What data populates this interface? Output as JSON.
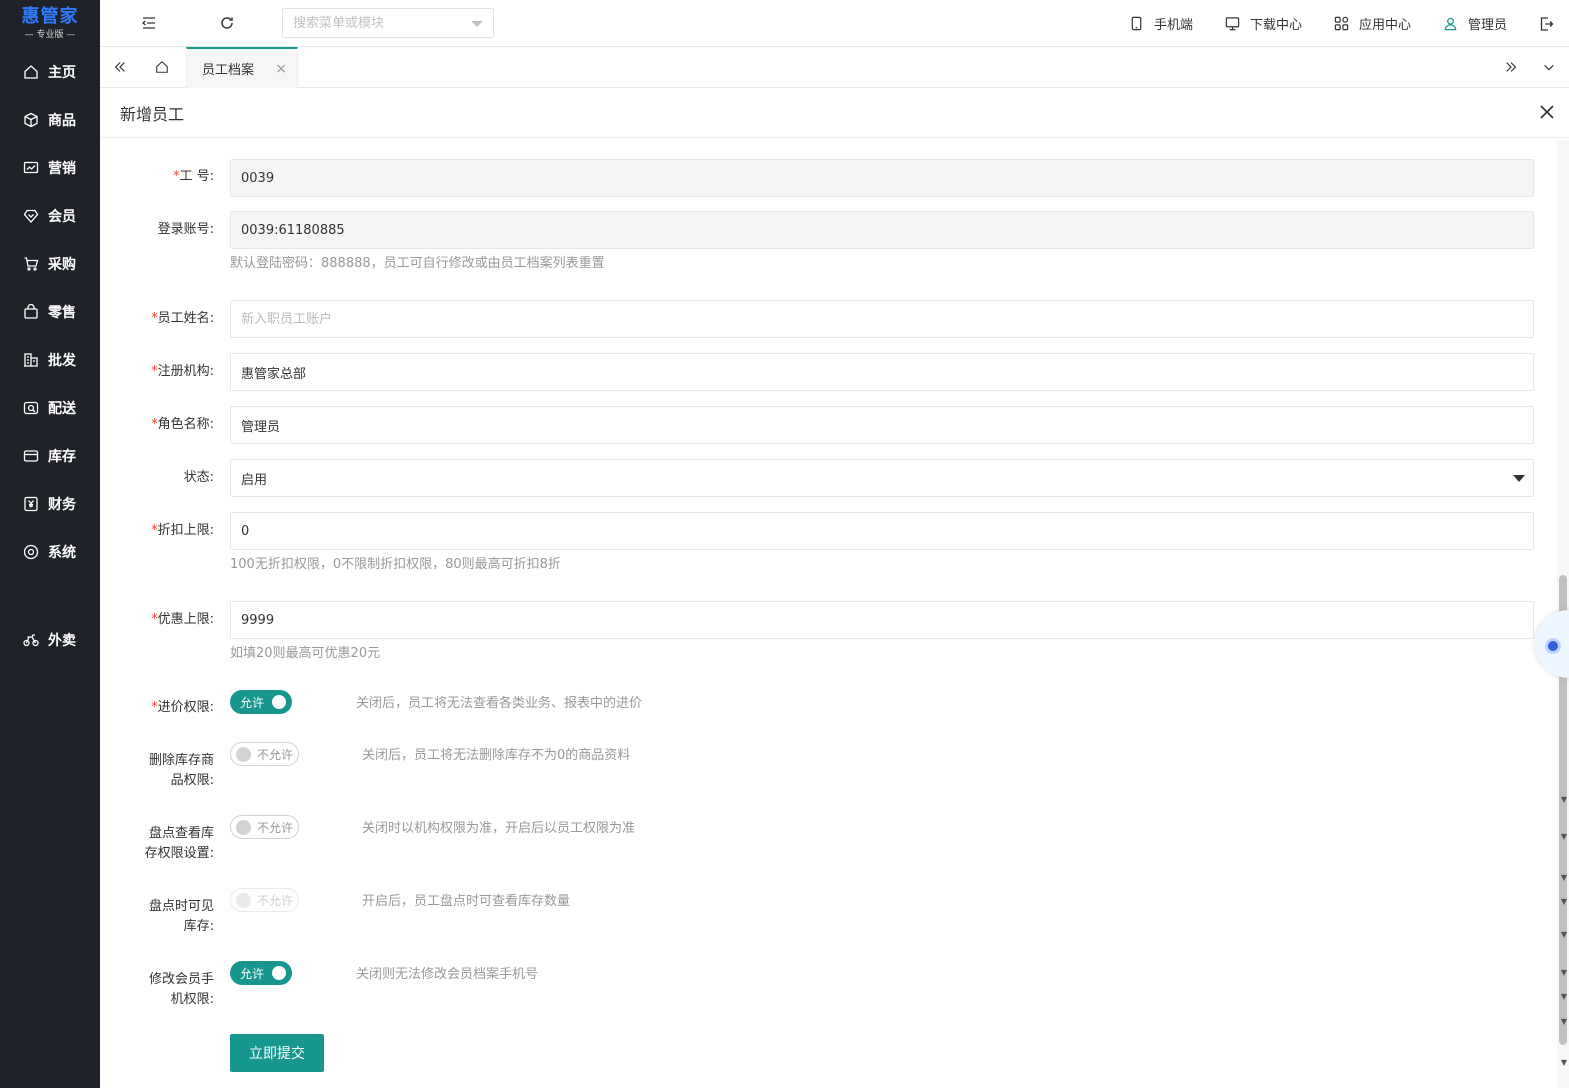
{
  "logo": {
    "main": "惠管家",
    "sub": "— 专业版 —"
  },
  "sidebar": {
    "items": [
      {
        "label": "主页",
        "icon": "home-icon"
      },
      {
        "label": "商品",
        "icon": "box-icon"
      },
      {
        "label": "营销",
        "icon": "chart-icon"
      },
      {
        "label": "会员",
        "icon": "heart-diamond-icon"
      },
      {
        "label": "采购",
        "icon": "cart-icon"
      },
      {
        "label": "零售",
        "icon": "bag-icon"
      },
      {
        "label": "批发",
        "icon": "building-icon"
      },
      {
        "label": "配送",
        "icon": "truck-icon"
      },
      {
        "label": "库存",
        "icon": "storage-icon"
      },
      {
        "label": "财务",
        "icon": "yen-icon"
      },
      {
        "label": "系统",
        "icon": "settings-icon"
      },
      {
        "label": "外卖",
        "icon": "bike-icon"
      }
    ]
  },
  "topbar": {
    "search_placeholder": "搜索菜单或模块",
    "links": {
      "mobile": "手机端",
      "download": "下载中心",
      "apps": "应用中心",
      "user": "管理员"
    }
  },
  "tabs": {
    "active": "员工档案"
  },
  "panel": {
    "title": "新增员工"
  },
  "form": {
    "employee_no": {
      "label": "工 号:",
      "value": "0039"
    },
    "login_account": {
      "label": "登录账号:",
      "value": "0039:61180885",
      "hint": "默认登陆密码：888888，员工可自行修改或由员工档案列表重置"
    },
    "employee_name": {
      "label": "员工姓名:",
      "placeholder": "新入职员工账户"
    },
    "org": {
      "label": "注册机构:",
      "value": "惠管家总部"
    },
    "role": {
      "label": "角色名称:",
      "value": "管理员"
    },
    "status": {
      "label": "状态:",
      "value": "启用"
    },
    "discount_limit": {
      "label": "折扣上限:",
      "value": "0",
      "hint": "100无折扣权限，0不限制折扣权限，80则最高可折扣8折"
    },
    "promo_limit": {
      "label": "优惠上限:",
      "value": "9999",
      "hint": "如填20则最高可优惠20元"
    },
    "cost_price": {
      "label": "进价权限:",
      "switch": "允许",
      "desc": "关闭后，员工将无法查看各类业务、报表中的进价"
    },
    "delete_stock": {
      "label_1": "删除库存商",
      "label_2": "品权限:",
      "switch": "不允许",
      "desc": "关闭后，员工将无法删除库存不为0的商品资料"
    },
    "stocktake_perm": {
      "label_1": "盘点查看库",
      "label_2": "存权限设置:",
      "switch": "不允许",
      "desc": "关闭时以机构权限为准，开启后以员工权限为准"
    },
    "stocktake_visible": {
      "label_1": "盘点时可见",
      "label_2": "库存:",
      "switch": "不允许",
      "desc": "开启后，员工盘点时可查看库存数量"
    },
    "edit_member_phone": {
      "label_1": "修改会员手",
      "label_2": "机权限:",
      "switch": "允许",
      "desc": "关闭则无法修改会员档案手机号"
    },
    "submit": "立即提交"
  },
  "colors": {
    "sidebar_bg": "#20222a",
    "accent": "#16968f",
    "logo": "#2f7bff",
    "required": "#ff3b30"
  }
}
